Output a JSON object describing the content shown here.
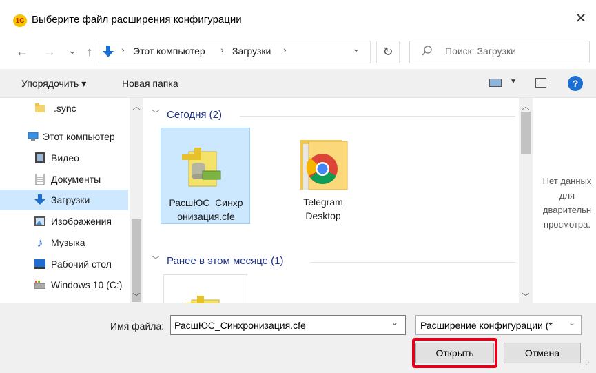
{
  "window": {
    "title": "Выберите файл расширения конфигурации",
    "logo_text": "1С",
    "close_glyph": "✕"
  },
  "nav": {
    "back": "←",
    "forward": "→",
    "recent": "⌄",
    "up": "↑",
    "breadcrumb": [
      "Этот компьютер",
      "Загрузки"
    ],
    "refresh": "↻",
    "search_placeholder": "Поиск: Загрузки"
  },
  "toolbar": {
    "organize": "Упорядочить ▾",
    "new_folder": "Новая папка",
    "help": "?"
  },
  "sidebar": {
    "items": [
      {
        "label": ".sync",
        "icon": "folder-icon"
      },
      {
        "label": "Этот компьютер",
        "icon": "computer-icon"
      },
      {
        "label": "Видео",
        "icon": "video-icon"
      },
      {
        "label": "Документы",
        "icon": "documents-icon"
      },
      {
        "label": "Загрузки",
        "icon": "downloads-icon",
        "selected": true
      },
      {
        "label": "Изображения",
        "icon": "pictures-icon"
      },
      {
        "label": "Музыка",
        "icon": "music-icon"
      },
      {
        "label": "Рабочий стол",
        "icon": "desktop-icon"
      },
      {
        "label": "Windows 10 (C:)",
        "icon": "drive-icon"
      }
    ]
  },
  "content": {
    "groups": [
      {
        "header": "Сегодня (2)",
        "items": [
          {
            "label_line1": "РасшЮС_Синхр",
            "label_line2": "онизация.cfe",
            "icon": "cfe-file-icon",
            "selected": true
          },
          {
            "label_line1": "Telegram",
            "label_line2": "Desktop",
            "icon": "chrome-folder-icon"
          }
        ]
      },
      {
        "header": "Ранее в этом месяце (1)",
        "items": [
          {
            "icon": "cfe-file-icon"
          }
        ]
      }
    ]
  },
  "preview": {
    "lines": [
      "Нет данных",
      "для",
      "дварительн",
      "просмотра."
    ]
  },
  "footer": {
    "filename_label": "Имя файла:",
    "filename_value": "РасшЮС_Синхронизация.cfe",
    "filetype_value": "Расширение конфигурации (*",
    "open_button": "Открыть",
    "cancel_button": "Отмена"
  },
  "colors": {
    "accent": "#1c6fd1",
    "selection": "#cce8ff",
    "highlight_border": "#e2001a"
  }
}
